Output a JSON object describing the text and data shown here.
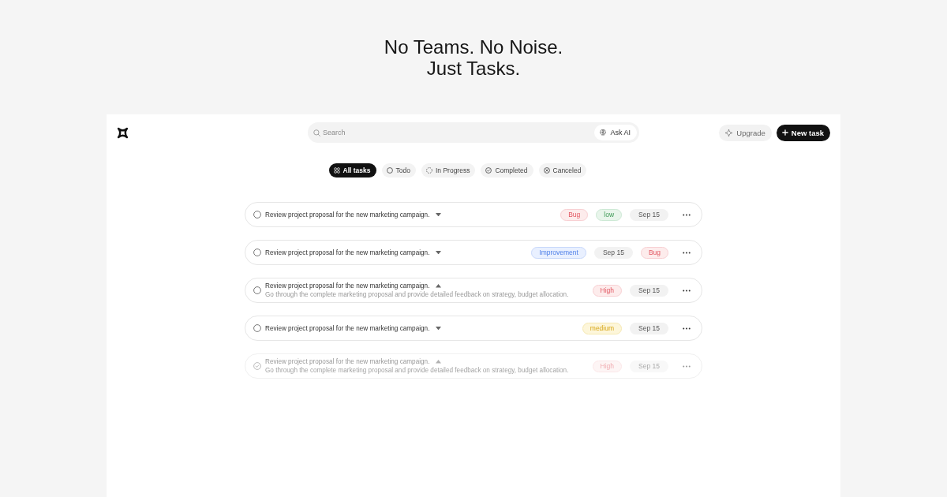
{
  "headline": {
    "lines": [
      "No Teams. No Noise.",
      "Just Tasks."
    ]
  },
  "toolbar": {
    "search": {
      "placeholder": "Search",
      "ask_ai": "Ask AI"
    },
    "upgrade": "Upgrade",
    "new_task": "New task"
  },
  "filters": [
    {
      "kind": "all",
      "label": "All tasks",
      "selected": true
    },
    {
      "kind": "todo",
      "label": "Todo",
      "selected": false
    },
    {
      "kind": "in_progress",
      "label": "In Progress",
      "selected": false
    },
    {
      "kind": "completed",
      "label": "Completed",
      "selected": false
    },
    {
      "kind": "canceled",
      "label": "Canceled",
      "selected": false
    }
  ],
  "tasks": [
    {
      "title": "Review project proposal for the new marketing campaign.",
      "completed": false,
      "expanded": false,
      "tags": [
        {
          "text": "Bug",
          "kind": "bug"
        },
        {
          "text": "low",
          "kind": "low"
        },
        {
          "text": "Sep 15",
          "kind": "date"
        }
      ]
    },
    {
      "title": "Review project proposal for the new marketing campaign.",
      "completed": false,
      "expanded": false,
      "tags": [
        {
          "text": "Improvement",
          "kind": "improvement"
        },
        {
          "text": "Sep 15",
          "kind": "date"
        },
        {
          "text": "Bug",
          "kind": "bug"
        }
      ]
    },
    {
      "title": "Review project proposal for the new marketing campaign.",
      "completed": false,
      "expanded": true,
      "description": "Go through the complete marketing proposal and provide detailed feedback on strategy, budget allocation.",
      "tags": [
        {
          "text": "High",
          "kind": "high"
        },
        {
          "text": "Sep 15",
          "kind": "date"
        }
      ]
    },
    {
      "title": "Review project proposal for the new marketing campaign.",
      "completed": false,
      "expanded": false,
      "tags": [
        {
          "text": "medium",
          "kind": "medium"
        },
        {
          "text": "Sep 15",
          "kind": "date"
        }
      ]
    },
    {
      "title": "Review project proposal for the new marketing campaign.",
      "completed": true,
      "expanded": true,
      "description": "Go through the complete marketing proposal and provide detailed feedback on strategy, budget allocation.",
      "tags": [
        {
          "text": "High",
          "kind": "high"
        },
        {
          "text": "Sep 15",
          "kind": "date"
        }
      ]
    }
  ]
}
